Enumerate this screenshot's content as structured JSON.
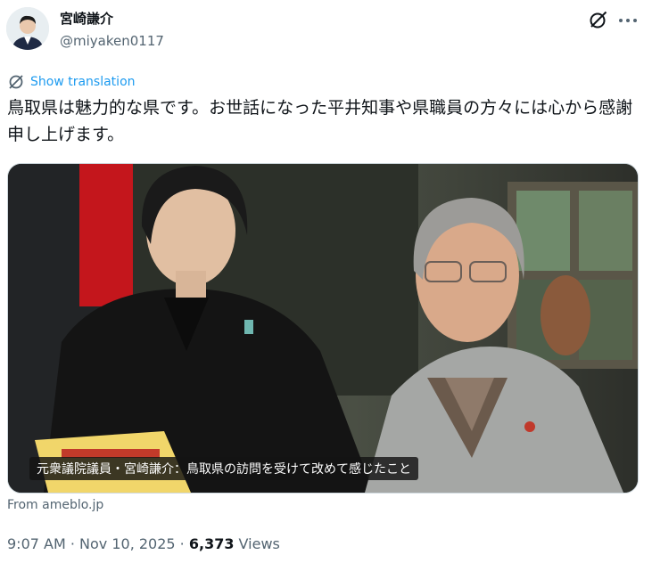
{
  "author": {
    "display_name": "宮崎謙介",
    "handle": "@miyaken0117",
    "avatar_icon": "profile-photo"
  },
  "header_actions": {
    "grok_icon": "grok-icon",
    "more_icon": "more-dots-icon"
  },
  "translation": {
    "label": "Show translation",
    "icon": "translate-icon"
  },
  "tweet": {
    "text": "鳥取県は魅力的な県です。お世話になった平井知事や県職員の方々には心から感謝申し上げます。"
  },
  "link_card": {
    "caption": "元衆議院議員・宮崎謙介：鳥取県の訪問を受けて改めて感じたこと",
    "source": "From ameblo.jp"
  },
  "meta": {
    "time": "9:07 AM",
    "separator": " · ",
    "date": "Nov 10, 2025",
    "views_count": "6,373",
    "views_label": " Views"
  },
  "colors": {
    "accent": "#1d9bf0",
    "text_primary": "#0f1419",
    "text_secondary": "#536471"
  }
}
